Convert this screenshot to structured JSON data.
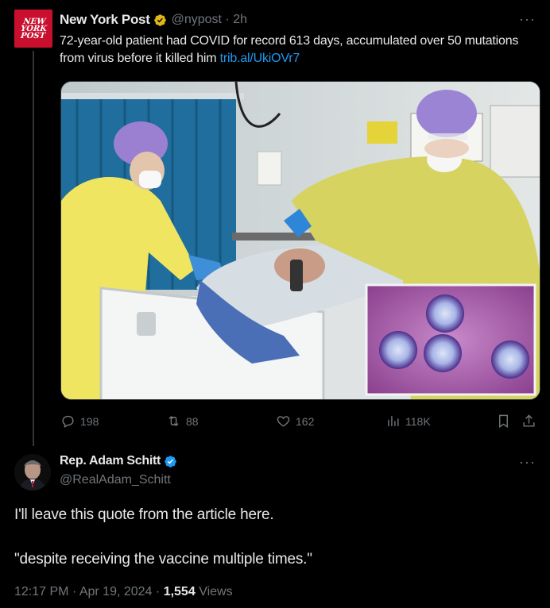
{
  "post1": {
    "author_name": "New York Post",
    "logo_text": [
      "NEW",
      "YORK",
      "POST"
    ],
    "handle": "@nypost",
    "separator": "·",
    "time": "2h",
    "more": "···",
    "text": "72-year-old patient had COVID for record 613 days, accumulated over 50 mutations from virus before it killed him",
    "link": "trib.al/UkiOVr7",
    "stats": {
      "replies": "198",
      "reposts": "88",
      "likes": "162",
      "views": "118K"
    }
  },
  "post2": {
    "author_name": "Rep. Adam Schitt",
    "handle": "@RealAdam_Schitt",
    "more": "···",
    "line1": "I'll leave this quote from the article here.",
    "line2": "\"despite receiving the vaccine multiple times.\"",
    "time": "12:17 PM",
    "date": "Apr 19, 2024",
    "views_count": "1,554",
    "views_label": "Views",
    "sep": "·"
  },
  "colors": {
    "background": "#000000",
    "text": "#e7e9ea",
    "muted": "#71767b",
    "link": "#1d9bf0",
    "gold_badge": "#e2b719",
    "blue_badge": "#1d9bf0",
    "nypost_red": "#c8102e"
  },
  "icons": [
    "reply-icon",
    "repost-icon",
    "like-icon",
    "views-icon",
    "bookmark-icon",
    "share-icon",
    "verified-gold-icon",
    "verified-blue-icon"
  ]
}
